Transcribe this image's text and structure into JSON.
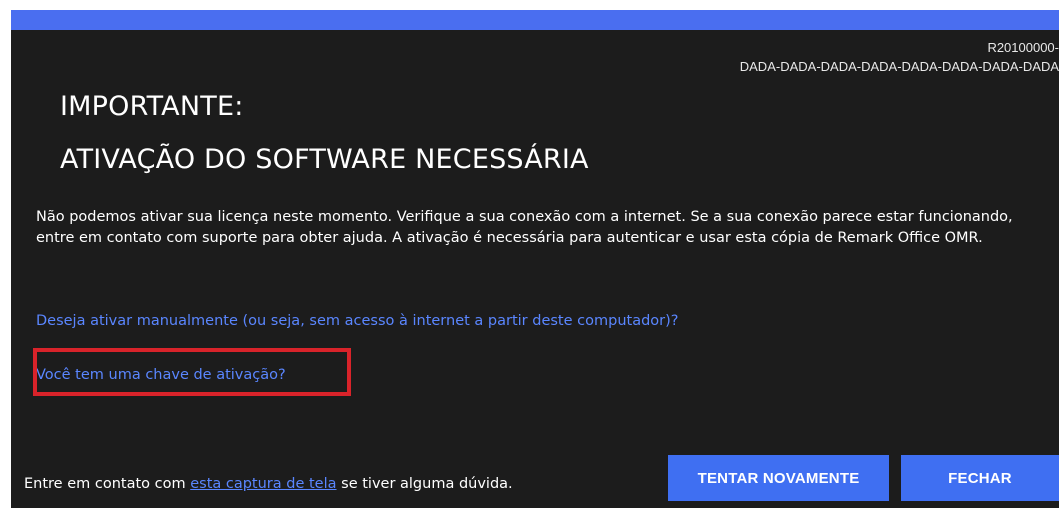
{
  "serial": {
    "line1": "R20100000-",
    "line2": "DADA-DADA-DADA-DADA-DADA-DADA-DADA-DADA"
  },
  "heading": {
    "line1": "IMPORTANTE:",
    "line2": "ATIVAÇÃO DO SOFTWARE NECESSÁRIA"
  },
  "message": "Não podemos ativar sua licença neste momento. Verifique a sua conexão com a internet. Se a sua conexão parece estar funcionando, entre em contato com suporte para obter ajuda. A ativação é necessária para autenticar e usar esta cópia de Remark Office OMR.",
  "links": {
    "manual_activation": "Deseja ativar manualmente (ou seja, sem acesso à internet a partir deste computador)?",
    "activation_key": "Você tem uma chave de ativação?"
  },
  "footer": {
    "prefix": "Entre em contato com ",
    "capture_link": "esta captura de tela",
    "suffix": " se tiver alguma dúvida."
  },
  "buttons": {
    "retry": "TENTAR NOVAMENTE",
    "close": "FECHAR"
  },
  "colors": {
    "title_bar": "#4a6ef0",
    "background": "#1c1c1c",
    "link": "#5a86ff",
    "button": "#3f6ff2",
    "highlight": "#d9232a"
  }
}
